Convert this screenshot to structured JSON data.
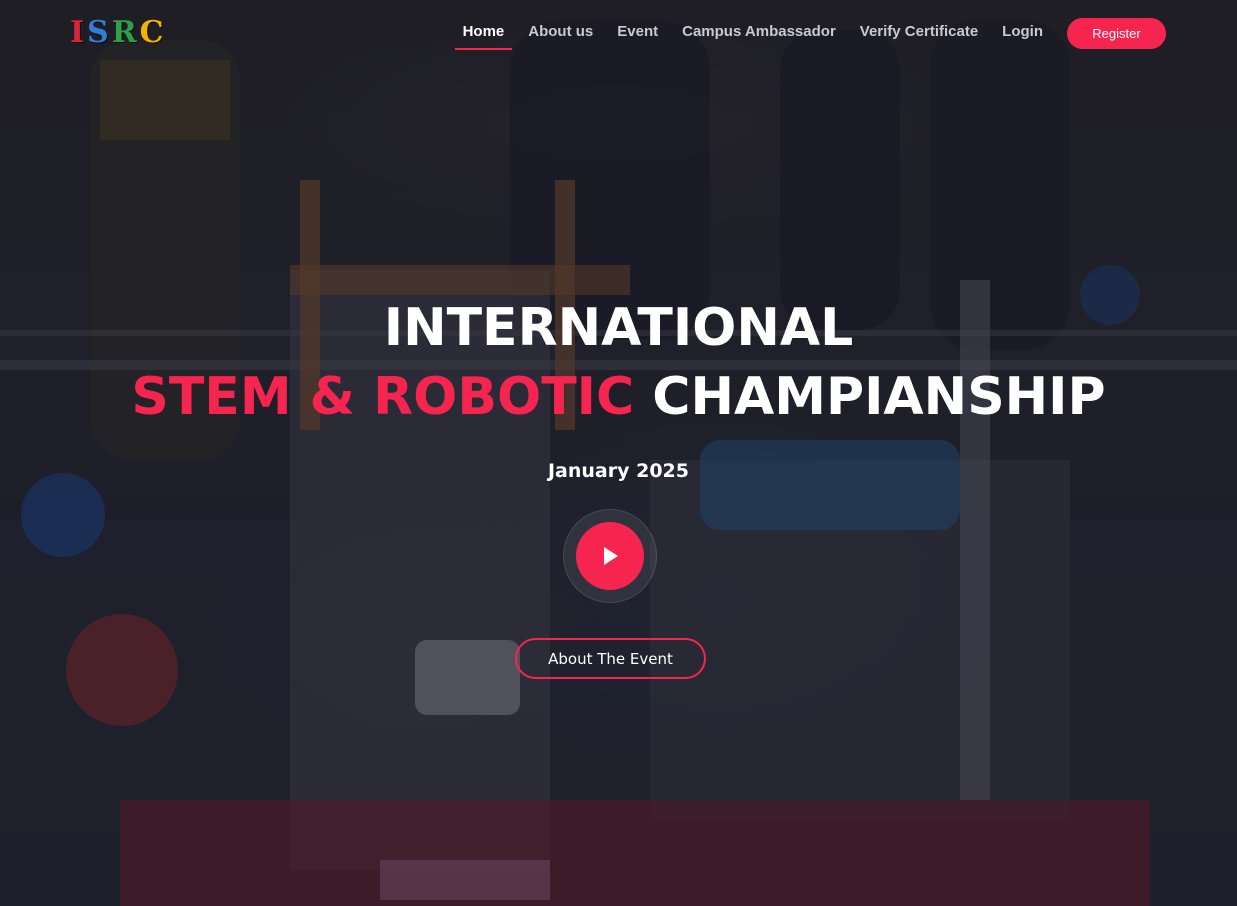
{
  "header": {
    "logo": {
      "letters": [
        "I",
        "S",
        "R",
        "C"
      ],
      "colors": [
        "#d9233a",
        "#2f7fd6",
        "#2e9e47",
        "#f2b400"
      ]
    },
    "nav": {
      "items": [
        {
          "label": "Home",
          "active": true
        },
        {
          "label": "About us",
          "active": false
        },
        {
          "label": "Event",
          "active": false
        },
        {
          "label": "Campus Ambassador",
          "active": false
        },
        {
          "label": "Verify Certificate",
          "active": false
        },
        {
          "label": "Login",
          "active": false
        }
      ],
      "register_label": "Register"
    }
  },
  "hero": {
    "title_line1": "INTERNATIONAL",
    "title_line2_accent": "STEM & ROBOTIC",
    "title_line2_rest": "CHAMPIANSHIP",
    "date": "January 2025",
    "play_icon": "play-icon",
    "cta_label": "About The Event"
  },
  "colors": {
    "accent": "#f5254f",
    "text": "#ffffff",
    "nav_inactive": "#c9c9d2"
  }
}
